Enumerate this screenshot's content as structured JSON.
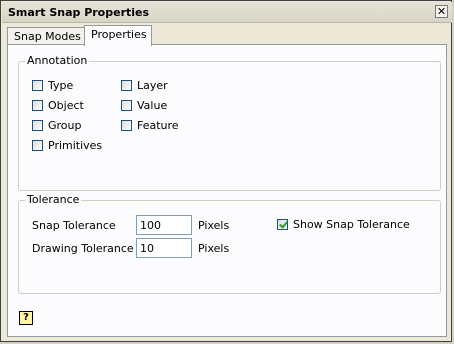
{
  "window": {
    "title": "Smart Snap Properties",
    "close_label": "✕"
  },
  "tabs": [
    {
      "label": "Snap Modes"
    },
    {
      "label": "Properties"
    }
  ],
  "annotation": {
    "title": "Annotation",
    "items": [
      {
        "label": "Type",
        "checked": false
      },
      {
        "label": "Object",
        "checked": false
      },
      {
        "label": "Group",
        "checked": false
      },
      {
        "label": "Primitives",
        "checked": false
      },
      {
        "label": "Layer",
        "checked": false
      },
      {
        "label": "Value",
        "checked": false
      },
      {
        "label": "Feature",
        "checked": false
      }
    ]
  },
  "tolerance": {
    "title": "Tolerance",
    "snap_label": "Snap Tolerance",
    "snap_value": "100",
    "snap_unit": "Pixels",
    "drawing_label": "Drawing Tolerance",
    "drawing_value": "10",
    "drawing_unit": "Pixels",
    "show_snap_label": "Show Snap Tolerance",
    "show_snap_checked": true
  },
  "help_icon": "help-icon"
}
